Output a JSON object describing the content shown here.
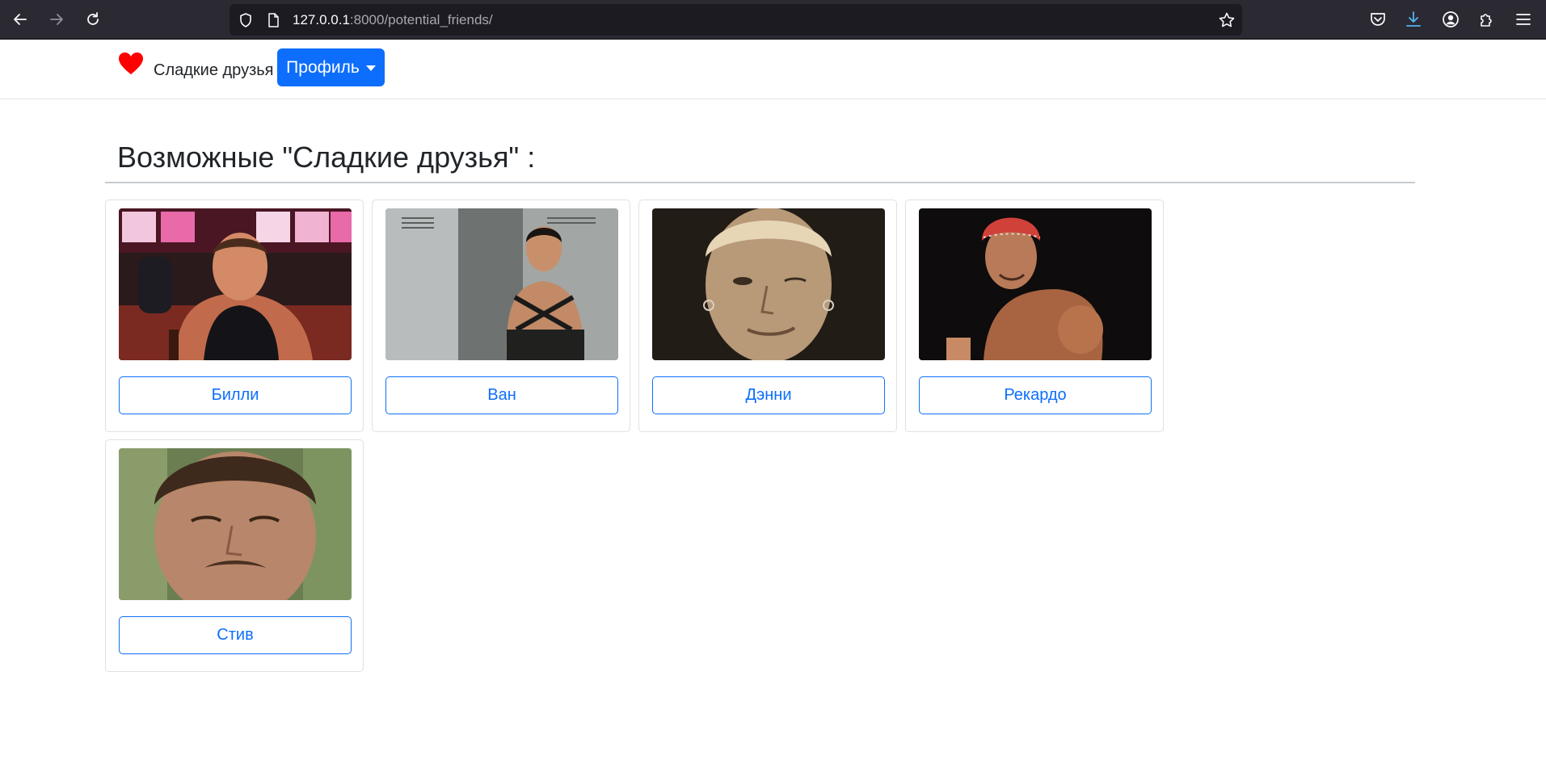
{
  "browser": {
    "url_host": "127.0.0.1",
    "url_rest": ":8000/potential_friends/"
  },
  "navbar": {
    "brand": "Сладкие друзья",
    "profile_button": "Профиль",
    "accent_color": "#0d6efd",
    "heart_color": "#ff0000"
  },
  "page": {
    "heading": "Возможные \"Сладкие друзья\" :"
  },
  "friends": [
    {
      "name": "Билли",
      "photo": "photo-billy"
    },
    {
      "name": "Ван",
      "photo": "photo-van"
    },
    {
      "name": "Дэнни",
      "photo": "photo-danny"
    },
    {
      "name": "Рекардо",
      "photo": "photo-ricardo"
    },
    {
      "name": "Стив",
      "photo": "photo-steve"
    }
  ]
}
